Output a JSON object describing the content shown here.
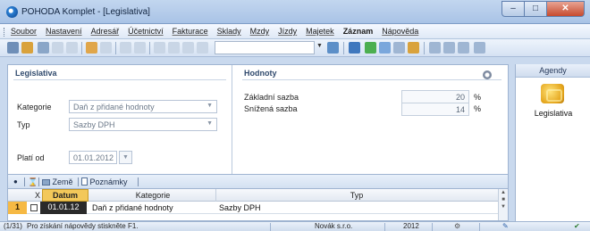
{
  "window": {
    "title": "POHODA Komplet - [Legislativa]"
  },
  "menu": [
    "Soubor",
    "Nastavení",
    "Adresář",
    "Účetnictví",
    "Fakturace",
    "Sklady",
    "Mzdy",
    "Jízdy",
    "Majetek",
    "Záznam",
    "Nápověda"
  ],
  "menu_bold_index": 9,
  "toolbar": {
    "search_value": ""
  },
  "left_panel": {
    "title": "Legislativa",
    "kategorie_label": "Kategorie",
    "kategorie_value": "Daň z přidané hodnoty",
    "typ_label": "Typ",
    "typ_value": "Sazby DPH",
    "plati_od_label": "Platí od",
    "plati_od_value": "01.01.2012"
  },
  "right_panel": {
    "title": "Hodnoty",
    "rows": [
      {
        "label": "Základní sazba",
        "value": "20",
        "unit": "%"
      },
      {
        "label": "Snížená sazba",
        "value": "14",
        "unit": "%"
      }
    ]
  },
  "agendy": {
    "header": "Agendy",
    "item_label": "Legislativa",
    "icon": "legislativa-icon"
  },
  "tabs": {
    "zeme": "Země",
    "poznamky": "Poznámky"
  },
  "grid": {
    "columns": {
      "x": "X",
      "datum": "Datum",
      "kategorie": "Kategorie",
      "typ": "Typ"
    },
    "rows": [
      {
        "num": "1",
        "datum": "01.01.12",
        "kategorie": "Daň z přidané hodnoty",
        "typ": "Sazby DPH"
      }
    ]
  },
  "status": {
    "position": "(1/31)",
    "hint": "Pro získání nápovědy stiskněte F1.",
    "company": "Novák s.r.o.",
    "year": "2012"
  },
  "colors": {
    "accent": "#f6b944",
    "title_gradient_top": "#c2d6ef",
    "selected_date_bg": "#2a2a2a"
  }
}
